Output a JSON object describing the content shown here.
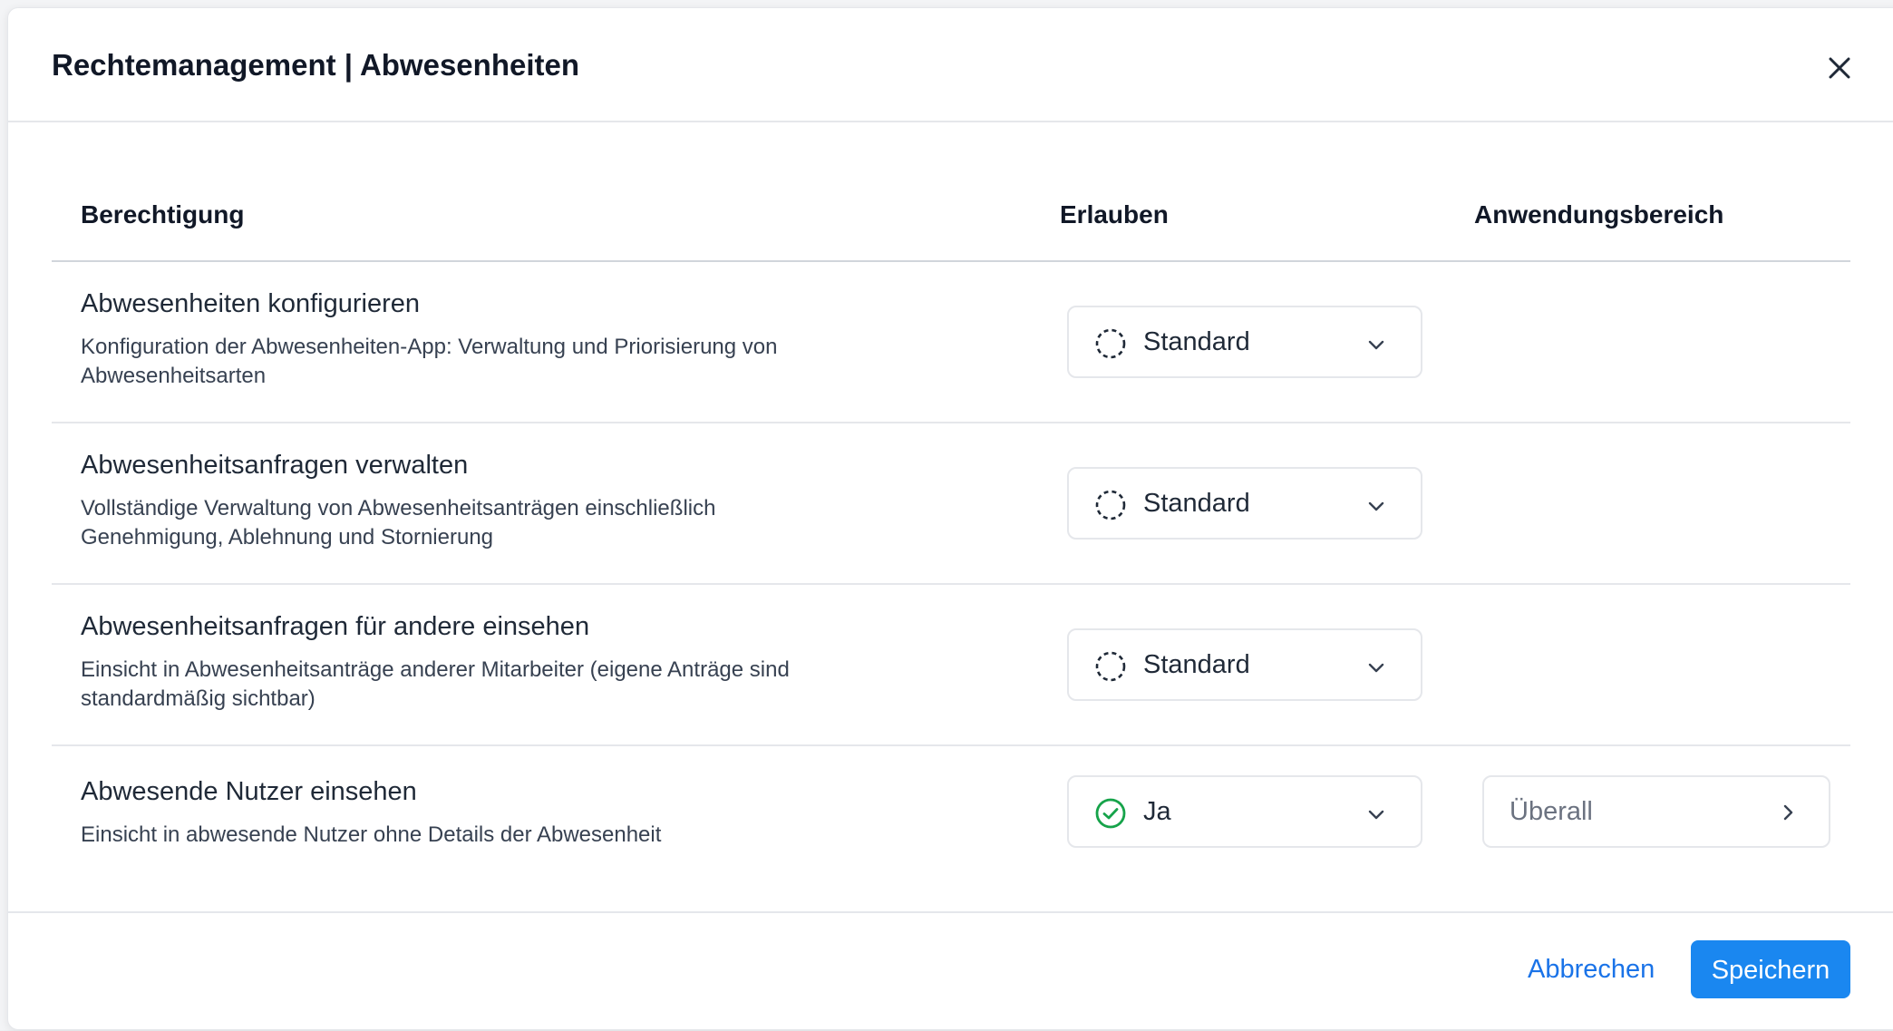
{
  "modal": {
    "title": "Rechtemanagement | Abwesenheiten"
  },
  "table": {
    "headers": {
      "permission": "Berechtigung",
      "allow": "Erlauben",
      "scope": "Anwendungsbereich"
    },
    "rows": [
      {
        "title": "Abwesenheiten konfigurieren",
        "description": "Konfiguration der Abwesenheiten-App: Verwaltung und Priorisierung von Abwesenheitsarten",
        "allow_value": "Standard",
        "allow_icon": "dashed-circle-icon"
      },
      {
        "title": "Abwesenheitsanfragen verwalten",
        "description": "Vollständige Verwaltung von Abwesenheitsanträgen einschließlich Genehmigung, Ablehnung und Stornierung",
        "allow_value": "Standard",
        "allow_icon": "dashed-circle-icon"
      },
      {
        "title": "Abwesenheitsanfragen für andere einsehen",
        "description": "Einsicht in Abwesenheitsanträge anderer Mitarbeiter (eigene Anträge sind standardmäßig sichtbar)",
        "allow_value": "Standard",
        "allow_icon": "dashed-circle-icon"
      },
      {
        "title": "Abwesende Nutzer einsehen",
        "description": "Einsicht in abwesende Nutzer ohne Details der Abwesenheit",
        "allow_value": "Ja",
        "allow_icon": "check-circle-icon",
        "scope_value": "Überall"
      }
    ]
  },
  "footer": {
    "cancel_label": "Abbrechen",
    "save_label": "Speichern"
  },
  "colors": {
    "accent": "#1a87f0",
    "link": "#1a73e8",
    "success": "#16a34a"
  }
}
